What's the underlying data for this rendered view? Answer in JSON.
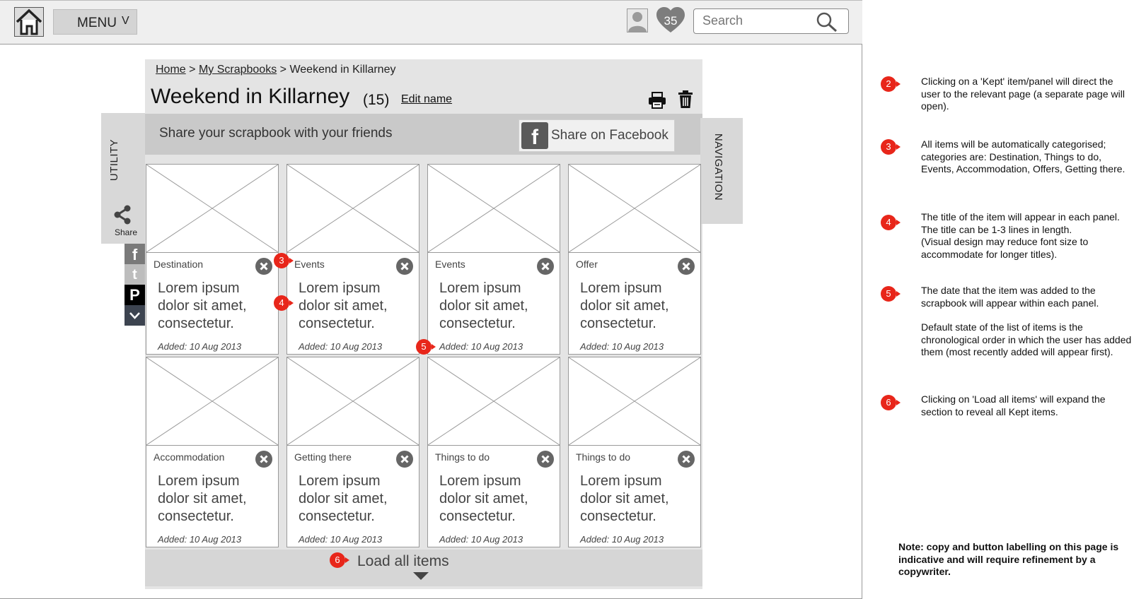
{
  "header": {
    "menu_label": "MENU",
    "menu_chevron": "V",
    "favourites_count": "35",
    "search_placeholder": "Search"
  },
  "breadcrumb": {
    "items": [
      "Home",
      "My Scrapbooks"
    ],
    "separator": ">",
    "current": "Weekend in Killarney"
  },
  "page": {
    "title": "Weekend in Killarney",
    "count": "(15)",
    "edit_label": "Edit name"
  },
  "share_bar": {
    "text": "Share your scrapbook with your friends",
    "facebook_label": "Share on Facebook",
    "facebook_glyph": "f"
  },
  "side": {
    "utility_label": "UTILITY",
    "share_label": "Share",
    "navigation_label": "NAVIGATION",
    "social": {
      "facebook": "f",
      "twitter": "t",
      "pinterest": "P"
    }
  },
  "cards": [
    {
      "category": "Destination",
      "title": "Lorem ipsum dolor sit amet, consectetur.",
      "added": "Added: 10 Aug 2013"
    },
    {
      "category": "Events",
      "title": "Lorem ipsum dolor sit amet, consectetur.",
      "added": "Added: 10 Aug 2013"
    },
    {
      "category": "Events",
      "title": "Lorem ipsum dolor sit amet, consectetur.",
      "added": "Added: 10 Aug 2013"
    },
    {
      "category": "Offer",
      "title": "Lorem ipsum dolor sit amet, consectetur.",
      "added": "Added: 10 Aug 2013"
    },
    {
      "category": "Accommodation",
      "title": "Lorem ipsum dolor sit amet, consectetur.",
      "added": "Added: 10 Aug 2013"
    },
    {
      "category": "Getting there",
      "title": "Lorem ipsum dolor sit amet, consectetur.",
      "added": "Added: 10 Aug 2013"
    },
    {
      "category": "Things to do",
      "title": "Lorem ipsum dolor sit amet, consectetur.",
      "added": "Added: 10 Aug 2013"
    },
    {
      "category": "Things to do",
      "title": "Lorem ipsum dolor sit amet, consectetur.",
      "added": "Added: 10 Aug 2013"
    }
  ],
  "load_all_label": "Load all items",
  "markers": [
    "2",
    "3",
    "4",
    "5",
    "6"
  ],
  "annotations": {
    "note_2": "Clicking on a 'Kept' item/panel will direct the user to the relevant page (a separate page will open).",
    "note_3": "All items will be automatically categorised; categories are: Destination, Things to do, Events, Accommodation, Offers, Getting there.",
    "note_4_a": "The title of the item will appear in each panel. The title can be 1-3 lines in length.",
    "note_4_b": "(Visual design may reduce font size to accommodate for longer titles).",
    "note_5_a": "The date that the item was added to the scrapbook will appear within each panel.",
    "note_5_b": "Default state of the list of items is the chronological order in which the user has added them (most recently added will appear first).",
    "note_6": "Clicking on 'Load all items' will expand the section to reveal all Kept items.",
    "disclaimer": "Note: copy and button labelling on this page is indicative and will require refinement by a copywriter."
  },
  "icons": {
    "home": "home-icon",
    "avatar": "user-icon",
    "favourites": "heart-icon",
    "search": "search-icon",
    "print": "print-icon",
    "delete": "trash-icon",
    "share": "share-icon",
    "close": "close-icon",
    "expand": "chevron-down-icon"
  },
  "colors": {
    "marker": "#e8261a",
    "panel": "#e4e4e4",
    "share_bar": "#c9c9c9"
  }
}
